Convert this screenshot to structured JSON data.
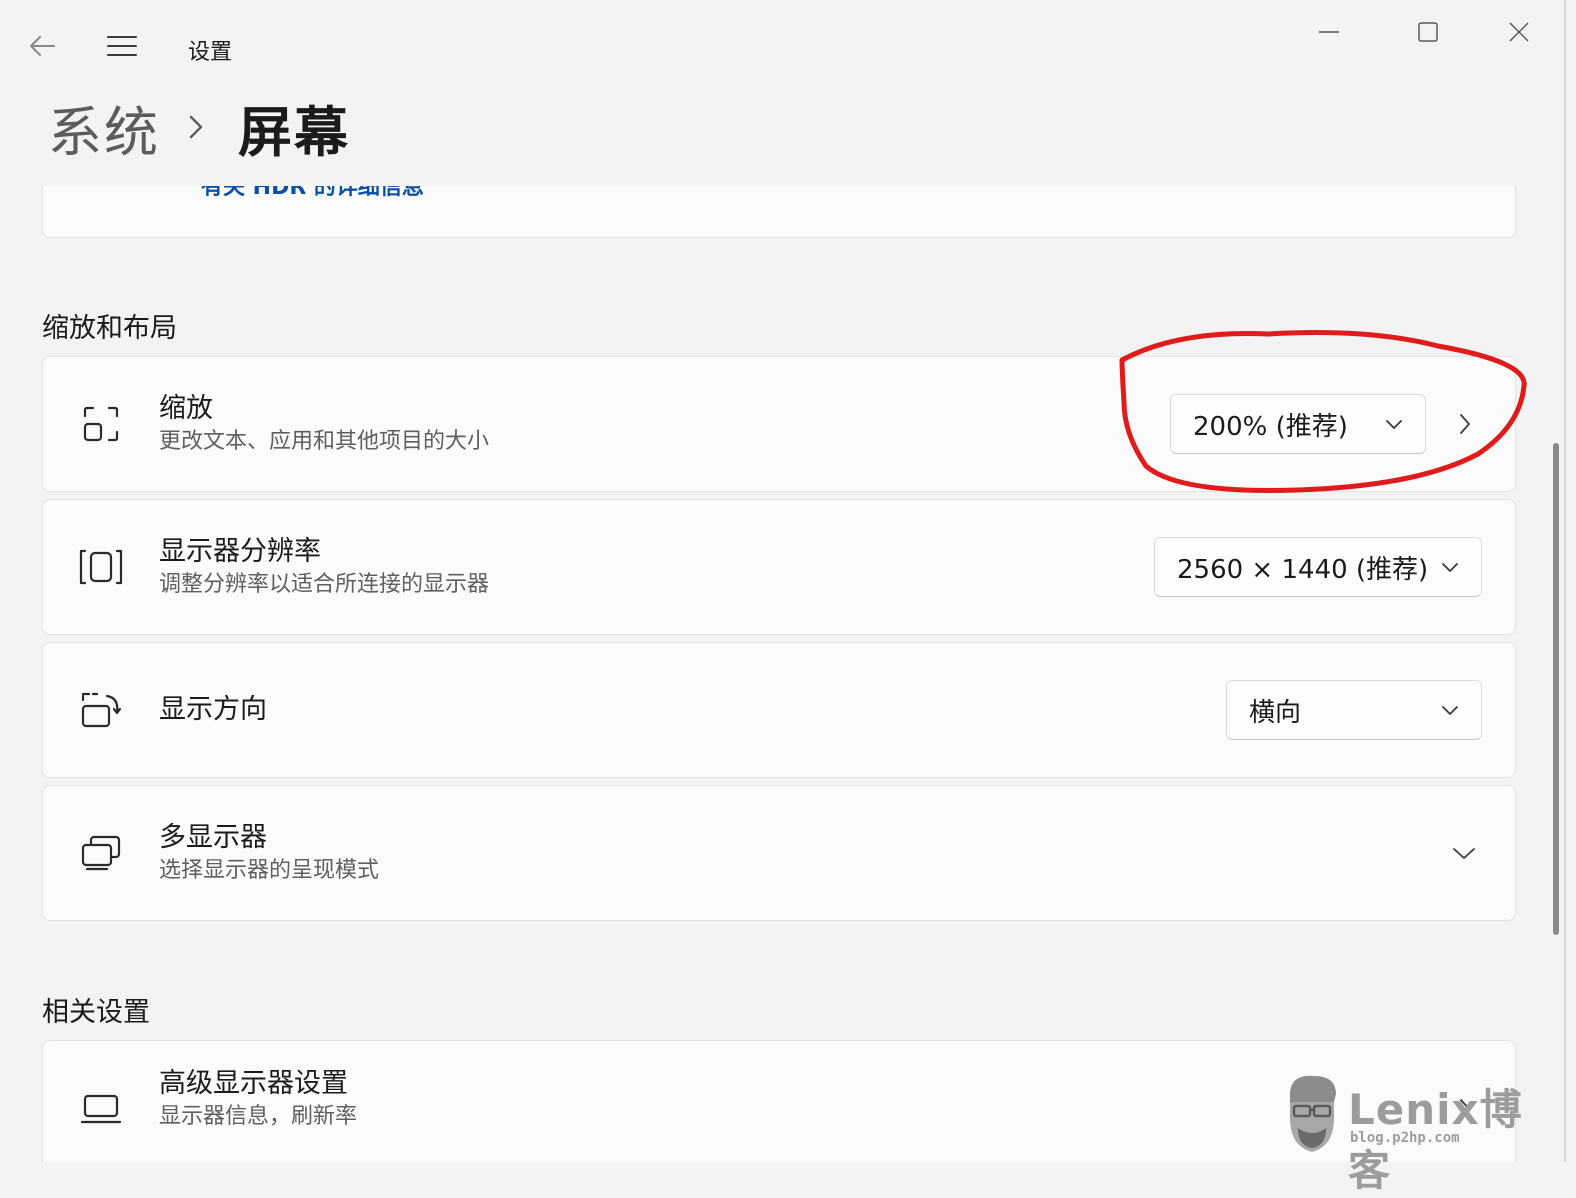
{
  "window": {
    "title": "设置",
    "back_icon": "back-arrow-icon",
    "menu_icon": "hamburger-menu-icon",
    "controls": [
      "minimize-icon",
      "maximize-icon",
      "close-icon"
    ]
  },
  "breadcrumb": {
    "parent": "系统",
    "current": "屏幕"
  },
  "hdr_card": {
    "link": "有关 HDR 的详细信息"
  },
  "scale_layout": {
    "section_title": "缩放和布局",
    "rows": [
      {
        "title": "缩放",
        "subtitle": "更改文本、应用和其他项目的大小",
        "icon": "scale-icon",
        "dropdown_value": "200% (推荐)"
      },
      {
        "title": "显示器分辨率",
        "subtitle": "调整分辨率以适合所连接的显示器",
        "icon": "resolution-icon",
        "dropdown_value": "2560 × 1440 (推荐)"
      },
      {
        "title": "显示方向",
        "icon": "orientation-icon",
        "dropdown_value": "横向"
      },
      {
        "title": "多显示器",
        "subtitle": "选择显示器的呈现模式",
        "icon": "multiple-displays-icon"
      }
    ]
  },
  "related": {
    "section_title": "相关设置",
    "rows": [
      {
        "title": "高级显示器设置",
        "subtitle": "显示器信息，刷新率",
        "icon": "laptop-icon"
      }
    ]
  },
  "watermark": {
    "brand": "Lenix博客",
    "url": "blog.p2hp.com"
  },
  "colors": {
    "background": "#f3f3f3",
    "card": "#fbfbfb",
    "link": "#0a4fa6",
    "annotation": "#e01b1b"
  }
}
